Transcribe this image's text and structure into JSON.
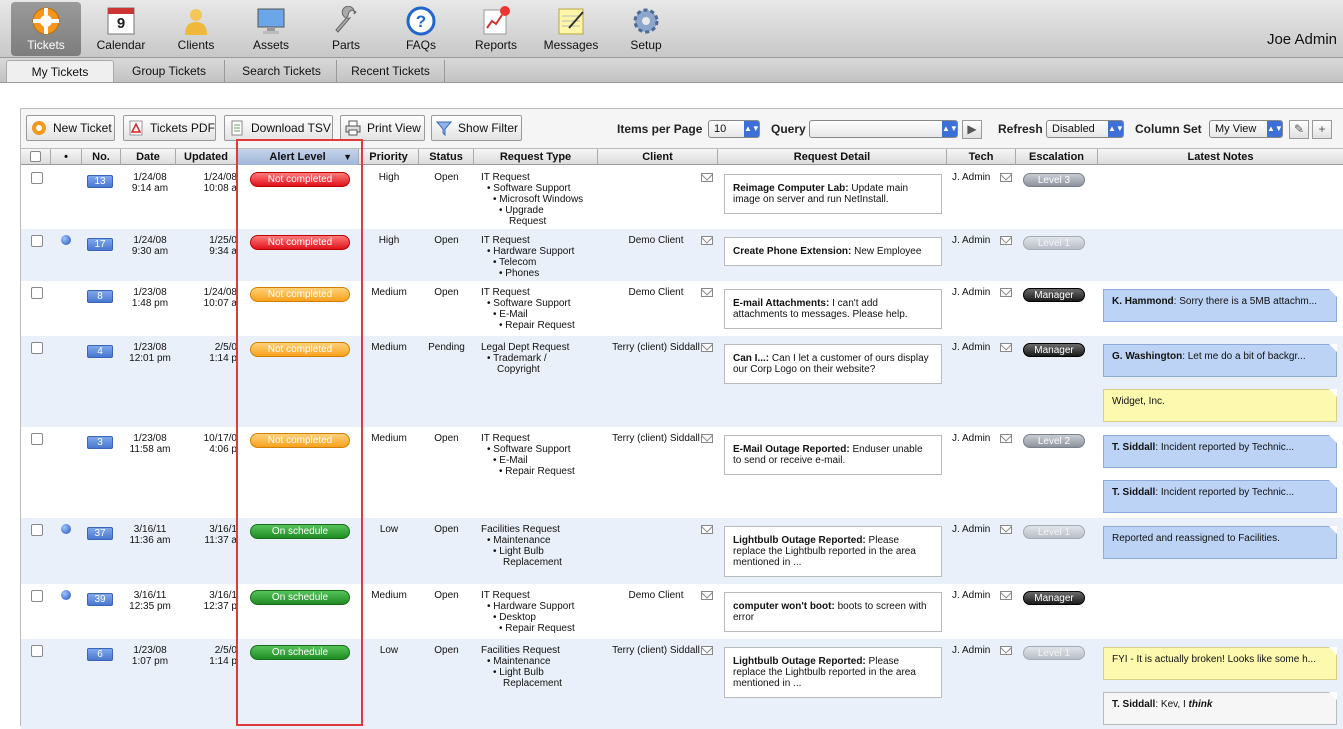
{
  "toolbar": {
    "items": [
      {
        "label": "Tickets",
        "icon": "lifebuoy-icon",
        "active": true
      },
      {
        "label": "Calendar",
        "icon": "calendar-icon",
        "calendar_day": "9"
      },
      {
        "label": "Clients",
        "icon": "person-icon"
      },
      {
        "label": "Assets",
        "icon": "monitor-icon"
      },
      {
        "label": "Parts",
        "icon": "wrench-icon"
      },
      {
        "label": "FAQs",
        "icon": "question-icon"
      },
      {
        "label": "Reports",
        "icon": "chart-icon"
      },
      {
        "label": "Messages",
        "icon": "notepad-icon"
      },
      {
        "label": "Setup",
        "icon": "gear-icon"
      }
    ],
    "user": "Joe Admin"
  },
  "subtabs": [
    "My Tickets",
    "Group Tickets",
    "Search Tickets",
    "Recent Tickets"
  ],
  "actions": {
    "new_ticket": "New Ticket",
    "tickets_pdf": "Tickets PDF",
    "download_tsv": "Download TSV",
    "print_view": "Print View",
    "show_filter": "Show Filter",
    "items_per_page_label": "Items per Page",
    "items_per_page_value": "10",
    "query_label": "Query",
    "query_value": "",
    "refresh_label": "Refresh",
    "refresh_value": "Disabled",
    "column_set_label": "Column Set",
    "column_set_value": "My View"
  },
  "columns": [
    "No.",
    "Date",
    "Updated",
    "Alert Level",
    "Priority",
    "Status",
    "Request Type",
    "Client",
    "Request Detail",
    "Tech",
    "Escalation",
    "Latest Notes"
  ],
  "tickets": [
    {
      "no": "13",
      "dot": false,
      "date": "1/24/08",
      "date_time": "9:14 am",
      "updated": "1/24/08",
      "updated_time": "10:08 a",
      "alert": "Not completed",
      "alert_color": "red",
      "priority": "High",
      "status": "Open",
      "type": [
        "IT Request",
        "• Software Support",
        "• Microsoft Windows",
        "• Upgrade",
        "Request"
      ],
      "client": "",
      "detail_title": "Reimage Computer Lab:",
      "detail_text": "Update main image on server and run NetInstall.",
      "tech": "J. Admin",
      "escalation": "Level 3",
      "esc_style": "grey",
      "notes": []
    },
    {
      "no": "17",
      "dot": true,
      "date": "1/24/08",
      "date_time": "9:30 am",
      "updated": "1/25/0",
      "updated_time": "9:34 a",
      "alert": "Not completed",
      "alert_color": "red",
      "priority": "High",
      "status": "Open",
      "type": [
        "IT Request",
        "• Hardware Support",
        "• Telecom",
        "• Phones"
      ],
      "client": "Demo Client",
      "detail_title": "Create Phone Extension:",
      "detail_text": "New Employee",
      "tech": "J. Admin",
      "escalation": "Level 1",
      "esc_style": "light",
      "notes": []
    },
    {
      "no": "8",
      "dot": false,
      "date": "1/23/08",
      "date_time": "1:48 pm",
      "updated": "1/24/08",
      "updated_time": "10:07 a",
      "alert": "Not completed",
      "alert_color": "orange",
      "priority": "Medium",
      "status": "Open",
      "type": [
        "IT Request",
        "• Software Support",
        "• E-Mail",
        "• Repair Request"
      ],
      "client": "Demo Client",
      "detail_title": "E-mail Attachments:",
      "detail_text": "I can't add attachments to messages. Please help.",
      "tech": "J. Admin",
      "escalation": "Manager",
      "esc_style": "dark",
      "notes": [
        {
          "author": "K. Hammond",
          "text": ": Sorry there is a 5MB attachm...",
          "style": "blue"
        }
      ]
    },
    {
      "no": "4",
      "dot": false,
      "date": "1/23/08",
      "date_time": "12:01 pm",
      "updated": "2/5/0",
      "updated_time": "1:14 p",
      "alert": "Not completed",
      "alert_color": "orange",
      "priority": "Medium",
      "status": "Pending",
      "type": [
        "Legal Dept Request",
        "• Trademark /",
        "Copyright"
      ],
      "client": "Terry (client) Siddall",
      "detail_title": "Can I...:",
      "detail_text": "Can I let a customer of ours display our Corp Logo on their website?",
      "tech": "J. Admin",
      "escalation": "Manager",
      "esc_style": "dark",
      "notes": [
        {
          "author": "G. Washington",
          "text": ": Let me do a bit of backgr...",
          "style": "blue"
        },
        {
          "author": "",
          "text": "Widget, Inc.",
          "style": "yellow"
        }
      ]
    },
    {
      "no": "3",
      "dot": false,
      "date": "1/23/08",
      "date_time": "11:58 am",
      "updated": "10/17/0",
      "updated_time": "4:06 p",
      "alert": "Not completed",
      "alert_color": "orange",
      "priority": "Medium",
      "status": "Open",
      "type": [
        "IT Request",
        "• Software Support",
        "• E-Mail",
        "• Repair Request"
      ],
      "client": "Terry (client) Siddall",
      "detail_title": "E-Mail Outage Reported:",
      "detail_text": "Enduser unable to send or receive e-mail.",
      "tech": "J. Admin",
      "escalation": "Level 2",
      "esc_style": "grey",
      "notes": [
        {
          "author": "T. Siddall",
          "text": ": Incident reported by Technic...",
          "style": "blue"
        },
        {
          "author": "T. Siddall",
          "text": ": Incident reported by Technic...",
          "style": "blue"
        }
      ]
    },
    {
      "no": "37",
      "dot": true,
      "date": "3/16/11",
      "date_time": "11:36 am",
      "updated": "3/16/1",
      "updated_time": "11:37 a",
      "alert": "On schedule",
      "alert_color": "green",
      "priority": "Low",
      "status": "Open",
      "type": [
        "Facilities Request",
        "• Maintenance",
        "• Light Bulb",
        "Replacement"
      ],
      "client": "",
      "detail_title": "Lightbulb Outage Reported:",
      "detail_text": "Please replace the Lightbulb reported in the area mentioned in ...",
      "tech": "J. Admin",
      "escalation": "Level 1",
      "esc_style": "light",
      "notes": [
        {
          "author": "",
          "text": "Reported and reassigned to Facilities.",
          "style": "blue"
        }
      ]
    },
    {
      "no": "39",
      "dot": true,
      "date": "3/16/11",
      "date_time": "12:35 pm",
      "updated": "3/16/1",
      "updated_time": "12:37 p",
      "alert": "On schedule",
      "alert_color": "green",
      "priority": "Medium",
      "status": "Open",
      "type": [
        "IT Request",
        "• Hardware Support",
        "• Desktop",
        "• Repair Request"
      ],
      "client": "Demo Client",
      "detail_title": "computer won't boot:",
      "detail_text": "boots to screen with error",
      "tech": "J. Admin",
      "escalation": "Manager",
      "esc_style": "dark",
      "notes": []
    },
    {
      "no": "6",
      "dot": false,
      "date": "1/23/08",
      "date_time": "1:07 pm",
      "updated": "2/5/0",
      "updated_time": "1:14 p",
      "alert": "On schedule",
      "alert_color": "green",
      "priority": "Low",
      "status": "Open",
      "type": [
        "Facilities Request",
        "• Maintenance",
        "• Light Bulb",
        "Replacement"
      ],
      "client": "Terry (client) Siddall",
      "detail_title": "Lightbulb Outage Reported:",
      "detail_text": "Please replace the Lightbulb reported in the area mentioned in ...",
      "tech": "J. Admin",
      "escalation": "Level 1",
      "esc_style": "light",
      "notes": [
        {
          "author": "",
          "text": "FYI - It is actually broken! Looks like some h...",
          "style": "yellow"
        },
        {
          "author": "T. Siddall",
          "text": ": Kev, I ",
          "emph": "think",
          "style": "white"
        }
      ]
    }
  ]
}
